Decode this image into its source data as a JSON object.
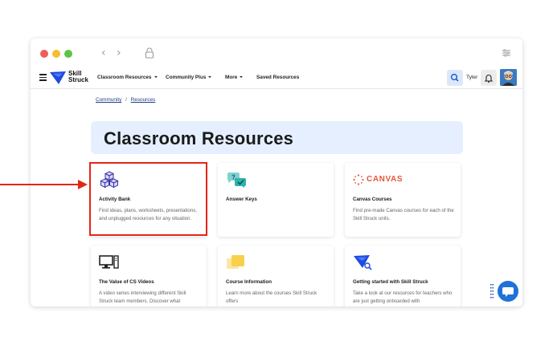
{
  "browser": {
    "back_icon": "chevron-left",
    "forward_icon": "chevron-right",
    "lock_icon": "lock",
    "settings_icon": "sliders",
    "traffic_lights": [
      "#ee5f57",
      "#f5bd2f",
      "#5ec445"
    ]
  },
  "app": {
    "brand": {
      "line1": "Skill",
      "line2": "Struck",
      "color": "#1f4be0"
    },
    "menu": [
      {
        "label": "Classroom Resources",
        "has_caret": true
      },
      {
        "label": "Community Plus",
        "has_caret": true
      },
      {
        "label": "More",
        "has_caret": true
      },
      {
        "label": "Saved Resources",
        "has_caret": false
      }
    ],
    "user_name": "Tyler"
  },
  "breadcrumb": {
    "items": [
      "Community",
      "Resources"
    ],
    "separator": "/"
  },
  "page": {
    "title": "Classroom Resources"
  },
  "cards": [
    {
      "icon": "cubes-icon",
      "title": "Activity Bank",
      "description": "Find ideas, plans, worksheets, presentations, and unplugged resources for any situation."
    },
    {
      "icon": "question-chat-icon",
      "title": "Answer Keys",
      "description": ""
    },
    {
      "icon": "canvas-logo",
      "logo_text": "CANVAS",
      "title": "Canvas Courses",
      "description": "Find pre-made Canvas courses for each of the Skill Struck units."
    },
    {
      "icon": "computer-icon",
      "title": "The Value of CS Videos",
      "description": "A video series interviewing different Skill Struck team members. Discover what"
    },
    {
      "icon": "notes-icon",
      "title": "Course Information",
      "description": "Learn more about the courses Skill Struck offers"
    },
    {
      "icon": "rocket-icon",
      "title": "Getting started with Skill Struck",
      "description": "Take a look at our resources for teachers who are just getting onboarded with"
    }
  ],
  "annotation": {
    "color": "#e52416",
    "highlighted_card": "Activity Bank"
  },
  "colors": {
    "accent": "#1e73d6",
    "hero_bg": "#e5efff",
    "canvas_red": "#e4573d"
  }
}
